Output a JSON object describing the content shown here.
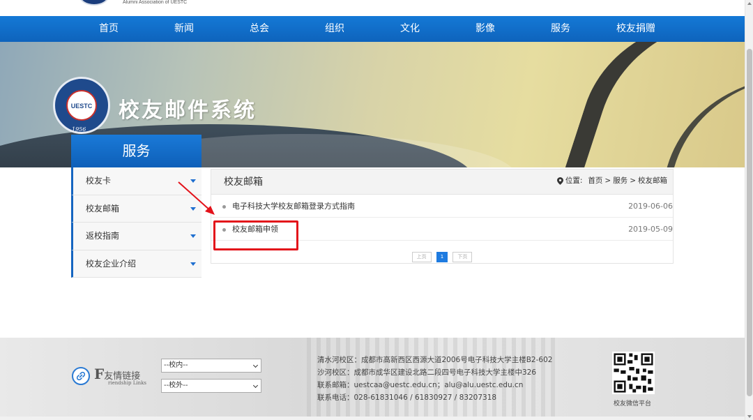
{
  "header": {
    "logo_subtitle": "Alumni Association of UESTC"
  },
  "nav": {
    "items": [
      "首页",
      "新闻",
      "总会",
      "组织",
      "文化",
      "影像",
      "服务",
      "校友捐赠"
    ]
  },
  "banner": {
    "title": "校友邮件系统",
    "emblem_text": "UESTC",
    "emblem_year": "1956"
  },
  "sidebar": {
    "heading": "服务",
    "items": [
      {
        "label": "校友卡"
      },
      {
        "label": "校友邮箱"
      },
      {
        "label": "返校指南"
      },
      {
        "label": "校友企业介绍"
      }
    ]
  },
  "content": {
    "title": "校友邮箱",
    "breadcrumb": {
      "prefix": "位置:",
      "home": "首页",
      "sep1": ">",
      "section": "服务",
      "sep2": ">",
      "current": "校友邮箱"
    },
    "articles": [
      {
        "title": "电子科技大学校友邮箱登录方式指南",
        "date": "2019-06-06"
      },
      {
        "title": "校友邮箱申领",
        "date": "2019-05-09"
      }
    ],
    "pager": {
      "prev": "上页",
      "current": "1",
      "next": "下页"
    }
  },
  "footer": {
    "links_title_letter": "F",
    "links_title_cn": "友情链接",
    "links_title_en": "riendship Links",
    "select_internal": "--校内--",
    "select_external": "--校外--",
    "address_lines": [
      "清水河校区：成都市高新西区西源大道2006号电子科技大学主楼B2-602",
      "沙河校区：成都市成华区建设北路二段四号电子科技大学主楼中326",
      "联系邮箱：uestcaa@uestc.edu.cn；alu@alu.uestc.edu.cn",
      "联系电话：028-61831046 / 61830927 / 83207318"
    ],
    "qr_label": "校友微信平台"
  },
  "colors": {
    "nav_blue": "#1479d6",
    "annotation_red": "#e3121a"
  }
}
